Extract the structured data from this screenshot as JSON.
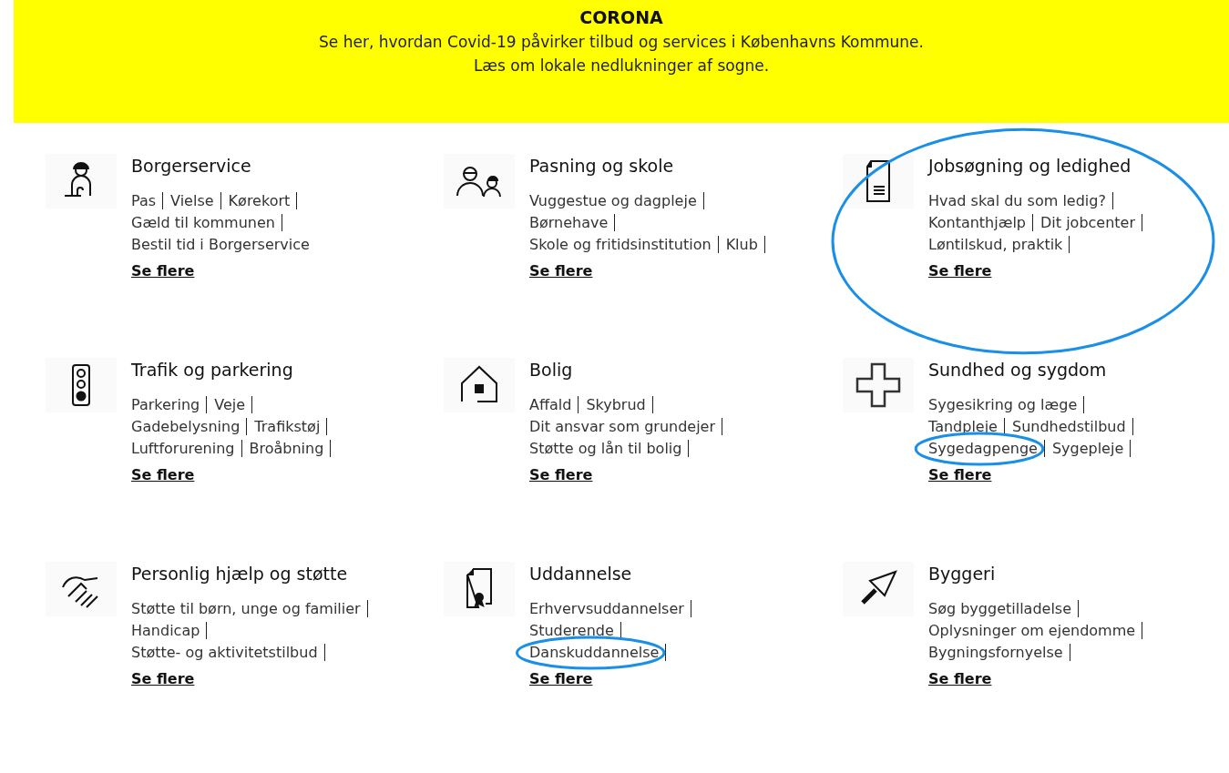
{
  "banner": {
    "title": "CORONA",
    "lines": [
      "Se her, hvordan Covid-19 påvirker tilbud og services i Københavns Kommune.",
      "Læs om lokale nedlukninger af sogne."
    ]
  },
  "categories": [
    {
      "kind": "borger",
      "title": "Borgerservice",
      "circled": false,
      "lines": [
        [
          {
            "text": "Pas",
            "circled": false,
            "bar": true
          },
          {
            "text": "Vielse",
            "circled": false,
            "bar": true
          },
          {
            "text": "Kørekort",
            "circled": false,
            "bar": true
          }
        ],
        [
          {
            "text": "Gæld til kommunen",
            "circled": false,
            "bar": true
          }
        ],
        [
          {
            "text": "Bestil tid i Borgerservice",
            "circled": false,
            "bar": false
          }
        ]
      ],
      "more": "Se flere"
    },
    {
      "kind": "pasning",
      "title": "Pasning og skole",
      "circled": false,
      "lines": [
        [
          {
            "text": "Vuggestue og dagpleje",
            "circled": false,
            "bar": true
          }
        ],
        [
          {
            "text": "Børnehave",
            "circled": false,
            "bar": true
          }
        ],
        [
          {
            "text": "Skole og fritidsinstitution",
            "circled": false,
            "bar": true
          },
          {
            "text": "Klub",
            "circled": false,
            "bar": true
          }
        ]
      ],
      "more": "Se flere"
    },
    {
      "kind": "job",
      "title": "Jobsøgning og ledighed",
      "circled": true,
      "lines": [
        [
          {
            "text": "Hvad skal du som ledig?",
            "circled": false,
            "bar": true
          }
        ],
        [
          {
            "text": "Kontanthjælp",
            "circled": false,
            "bar": true
          },
          {
            "text": "Dit jobcenter",
            "circled": false,
            "bar": true
          }
        ],
        [
          {
            "text": "Løntilskud, praktik",
            "circled": false,
            "bar": true
          }
        ]
      ],
      "more": "Se flere"
    },
    {
      "kind": "trafik",
      "title": "Trafik og parkering",
      "circled": false,
      "lines": [
        [
          {
            "text": "Parkering",
            "circled": false,
            "bar": true
          },
          {
            "text": "Veje",
            "circled": false,
            "bar": true
          }
        ],
        [
          {
            "text": "Gadebelysning",
            "circled": false,
            "bar": true
          },
          {
            "text": "Trafikstøj",
            "circled": false,
            "bar": true
          }
        ],
        [
          {
            "text": "Luftforurening",
            "circled": false,
            "bar": true
          },
          {
            "text": "Broåbning",
            "circled": false,
            "bar": true
          }
        ]
      ],
      "more": "Se flere"
    },
    {
      "kind": "bolig",
      "title": "Bolig",
      "circled": false,
      "lines": [
        [
          {
            "text": "Affald",
            "circled": false,
            "bar": true
          },
          {
            "text": "Skybrud",
            "circled": false,
            "bar": true
          }
        ],
        [
          {
            "text": "Dit ansvar som grundejer",
            "circled": false,
            "bar": true
          }
        ],
        [
          {
            "text": "Støtte og lån til bolig",
            "circled": false,
            "bar": true
          }
        ]
      ],
      "more": "Se flere"
    },
    {
      "kind": "sundhed",
      "title": "Sundhed og sygdom",
      "circled": false,
      "lines": [
        [
          {
            "text": "Sygesikring og læge",
            "circled": false,
            "bar": true
          }
        ],
        [
          {
            "text": "Tandpleje",
            "circled": false,
            "bar": true
          },
          {
            "text": "Sundhedstilbud",
            "circled": false,
            "bar": true
          }
        ],
        [
          {
            "text": "Sygedagpenge",
            "circled": true,
            "bar": true
          },
          {
            "text": "Sygepleje",
            "circled": false,
            "bar": true
          }
        ]
      ],
      "more": "Se flere"
    },
    {
      "kind": "hjaelp",
      "title": "Personlig hjælp og støtte",
      "circled": false,
      "lines": [
        [
          {
            "text": "Støtte til børn, unge og familier",
            "circled": false,
            "bar": true
          }
        ],
        [
          {
            "text": "Handicap",
            "circled": false,
            "bar": true
          }
        ],
        [
          {
            "text": "Støtte- og aktivitetstilbud",
            "circled": false,
            "bar": true
          }
        ]
      ],
      "more": "Se flere"
    },
    {
      "kind": "uddannelse",
      "title": "Uddannelse",
      "circled": false,
      "lines": [
        [
          {
            "text": "Erhvervsuddannelser",
            "circled": false,
            "bar": true
          }
        ],
        [
          {
            "text": "Studerende",
            "circled": false,
            "bar": true
          }
        ],
        [
          {
            "text": "Danskuddannelse",
            "circled": true,
            "bar": true
          }
        ]
      ],
      "more": "Se flere"
    },
    {
      "kind": "byggeri",
      "title": "Byggeri",
      "circled": false,
      "lines": [
        [
          {
            "text": "Søg byggetilladelse",
            "circled": false,
            "bar": true
          }
        ],
        [
          {
            "text": "Oplysninger om ejendomme",
            "circled": false,
            "bar": true
          }
        ],
        [
          {
            "text": "Bygningsfornyelse",
            "circled": false,
            "bar": true
          }
        ]
      ],
      "more": "Se flere"
    }
  ]
}
